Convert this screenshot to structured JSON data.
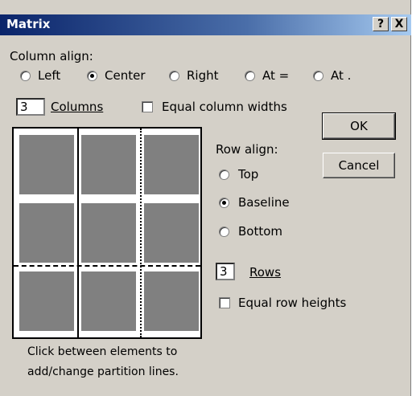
{
  "window": {
    "title": "Matrix",
    "help_label": "?",
    "close_label": "X"
  },
  "column_align": {
    "label": "Column align:",
    "options": [
      {
        "label": "Left",
        "selected": false
      },
      {
        "label": "Center",
        "selected": true
      },
      {
        "label": "Right",
        "selected": false
      },
      {
        "label": "At =",
        "selected": false
      },
      {
        "label": "At .",
        "selected": false
      }
    ]
  },
  "columns": {
    "value": "3",
    "label": "Columns"
  },
  "equal_column_widths": {
    "label": "Equal column widths",
    "checked": false
  },
  "row_align": {
    "label": "Row align:",
    "options": [
      {
        "label": "Top",
        "selected": false
      },
      {
        "label": "Baseline",
        "selected": true
      },
      {
        "label": "Bottom",
        "selected": false
      }
    ]
  },
  "rows": {
    "value": "3",
    "label": "Rows"
  },
  "equal_row_heights": {
    "label": "Equal row heights",
    "checked": false
  },
  "buttons": {
    "ok": "OK",
    "cancel": "Cancel"
  },
  "hint": {
    "line1": "Click between elements to",
    "line2": "add/change partition lines."
  },
  "colors": {
    "title_bar": "#0a246a",
    "dialog_bg": "#d4d0c8",
    "cell": "#808080"
  }
}
